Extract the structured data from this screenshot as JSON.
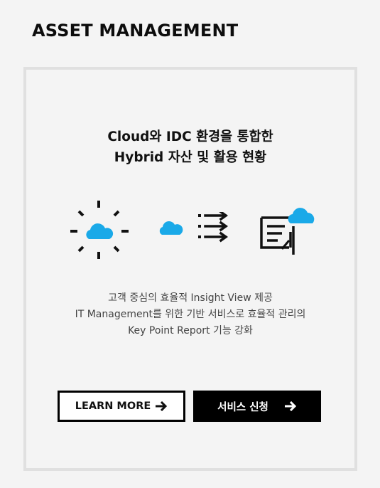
{
  "page": {
    "title": "ASSET MANAGEMENT"
  },
  "card": {
    "headline": [
      "Cloud와 IDC 환경을 통합한",
      "Hybrid 자산 및 활용 현황"
    ],
    "description": [
      "고객 중심의 효율적 Insight View 제공",
      "IT Management를 위한 기반 서비스로 효율적 관리의",
      "Key Point Report 기능 강화"
    ],
    "icons": [
      "cloud-sun-icon",
      "cloud-transfer-icon",
      "document-cloud-icon"
    ],
    "buttons": {
      "learn_more": "LEARN MORE",
      "apply": "서비스 신청"
    }
  },
  "colors": {
    "accent": "#1aa9e8",
    "dark": "#000000",
    "card_border": "#e0e0e0",
    "background": "#f4f4f4"
  }
}
